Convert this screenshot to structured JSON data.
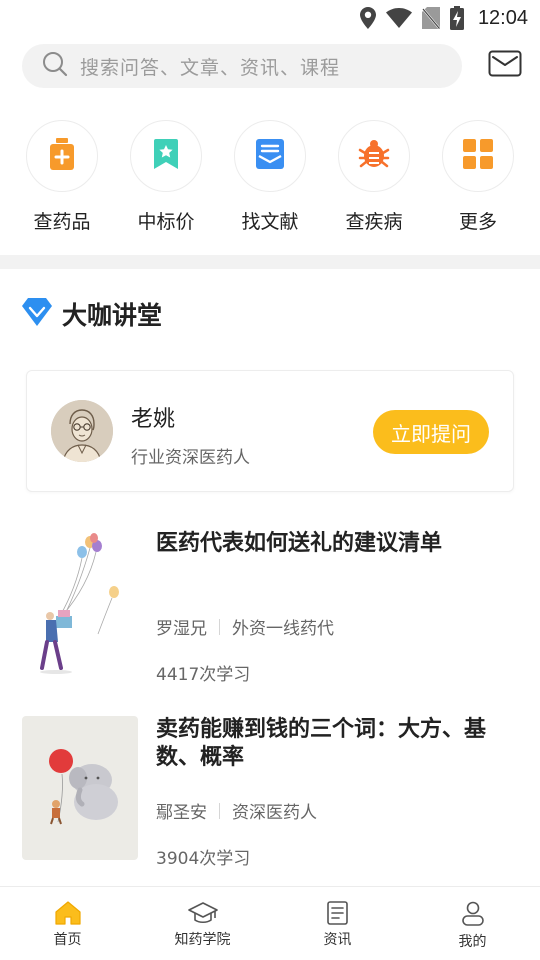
{
  "status_bar": {
    "time": "12:04",
    "icons": [
      "location-icon",
      "wifi-icon",
      "no-sim-icon",
      "battery-charging-icon"
    ]
  },
  "search": {
    "placeholder": "搜索问答、文章、资讯、课程",
    "icon": "search-icon",
    "mail_icon": "mail-icon"
  },
  "quick_actions": [
    {
      "label": "查药品",
      "icon": "medicine-bottle-icon",
      "color": "#f79a2b"
    },
    {
      "label": "中标价",
      "icon": "bookmark-star-icon",
      "color": "#3fd0b8"
    },
    {
      "label": "找文献",
      "icon": "document-envelope-icon",
      "color": "#3a8ff2"
    },
    {
      "label": "查疾病",
      "icon": "virus-bug-icon",
      "color": "#f7712b"
    },
    {
      "label": "更多",
      "icon": "grid-four-icon",
      "color": "#f79a2b"
    }
  ],
  "section": {
    "title": "大咖讲堂",
    "icon": "diamond-icon",
    "icon_color": "#2d8ff0"
  },
  "expert": {
    "name": "老姚",
    "title": "行业资深医药人",
    "button": "立即提问",
    "button_color": "#fbbd1c"
  },
  "articles": [
    {
      "title": "医药代表如何送礼的建议清单",
      "author": "罗湿兄",
      "author_title": "外资一线药代",
      "count": "4417次学习"
    },
    {
      "title": "卖药能赚到钱的三个词：大方、基数、概率",
      "author": "鄢圣安",
      "author_title": "资深医药人",
      "count": "3904次学习"
    }
  ],
  "tabs": [
    {
      "label": "首页",
      "icon": "home-icon",
      "active": true
    },
    {
      "label": "知药学院",
      "icon": "graduation-cap-icon",
      "active": false
    },
    {
      "label": "资讯",
      "icon": "news-icon",
      "active": false
    },
    {
      "label": "我的",
      "icon": "user-icon",
      "active": false
    }
  ],
  "colors": {
    "accent": "#fbbd1c",
    "text": "#222222",
    "muted": "#666666"
  }
}
